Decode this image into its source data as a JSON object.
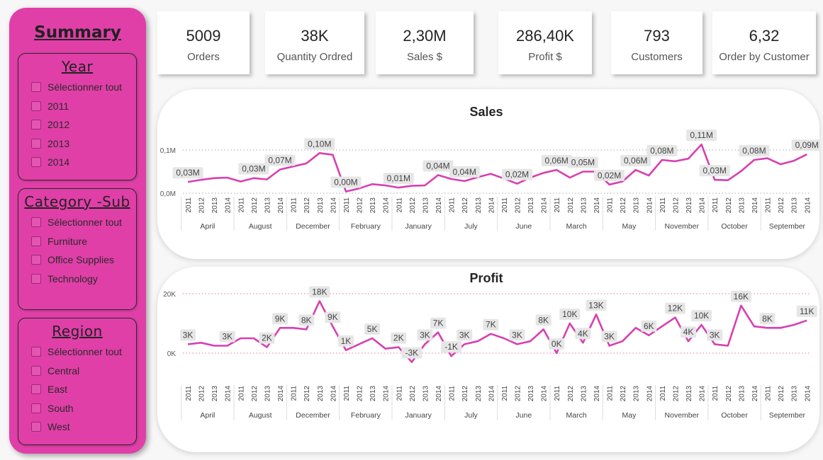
{
  "sidebar": {
    "title": "Summary",
    "year": {
      "title": "Year",
      "options": [
        "Sélectionner tout",
        "2011",
        "2012",
        "2013",
        "2014"
      ]
    },
    "category": {
      "title": "Category -Sub",
      "options": [
        "Sélectionner tout",
        "Furniture",
        "Office Supplies",
        "Technology"
      ]
    },
    "region": {
      "title": "Region",
      "options": [
        "Sélectionner tout",
        "Central",
        "East",
        "South",
        "West"
      ]
    }
  },
  "kpis": [
    {
      "value": "5009",
      "label": "Orders"
    },
    {
      "value": "38K",
      "label": "Quantity Ordred"
    },
    {
      "value": "2,30M",
      "label": "Sales $"
    },
    {
      "value": "286,40K",
      "label": "Profit $"
    },
    {
      "value": "793",
      "label": "Customers"
    },
    {
      "value": "6,32",
      "label": "Order by Customer"
    }
  ],
  "colors": {
    "accent": "#e03fa8",
    "line": "#d83fb1",
    "sidebar": "#e03fa8"
  },
  "chart_data": [
    {
      "type": "line",
      "title": "Sales",
      "x_years": [
        "2011",
        "2012",
        "2013",
        "2014"
      ],
      "x_months": [
        "April",
        "August",
        "December",
        "February",
        "January",
        "July",
        "June",
        "March",
        "May",
        "November",
        "October",
        "September"
      ],
      "y_ticks": [
        "0,0M",
        "0,1M"
      ],
      "ylim": [
        0,
        0.11
      ],
      "values": [
        0.026,
        0.031,
        0.035,
        0.036,
        0.027,
        0.035,
        0.032,
        0.055,
        0.062,
        0.069,
        0.093,
        0.089,
        0.004,
        0.011,
        0.021,
        0.018,
        0.013,
        0.017,
        0.018,
        0.042,
        0.033,
        0.028,
        0.037,
        0.045,
        0.034,
        0.022,
        0.036,
        0.047,
        0.054,
        0.036,
        0.05,
        0.05,
        0.02,
        0.027,
        0.054,
        0.041,
        0.077,
        0.074,
        0.08,
        0.113,
        0.031,
        0.03,
        0.051,
        0.077,
        0.081,
        0.067,
        0.075,
        0.09
      ],
      "data_labels": [
        "0,03M",
        "",
        "",
        "",
        "",
        "0,03M",
        "",
        "0,07M",
        "",
        "",
        "0,10M",
        "",
        "0,00M",
        "",
        "",
        "",
        "0,01M",
        "",
        "",
        "0,04M",
        "",
        "0,04M",
        "",
        "",
        "",
        "0,02M",
        "",
        "",
        "0,06M",
        "",
        "0,05M",
        "",
        "0,02M",
        "",
        "0,06M",
        "",
        "0,08M",
        "",
        "",
        "0,11M",
        "0,03M",
        "",
        "",
        "0,08M",
        "",
        "",
        "",
        "0,09M"
      ]
    },
    {
      "type": "line",
      "title": "Profit",
      "x_years": [
        "2011",
        "2012",
        "2013",
        "2014"
      ],
      "x_months": [
        "April",
        "August",
        "December",
        "February",
        "January",
        "July",
        "June",
        "March",
        "May",
        "November",
        "October",
        "September"
      ],
      "y_ticks": [
        "0K",
        "20K"
      ],
      "ylim": [
        -3,
        20
      ],
      "values": [
        3,
        3.5,
        2.5,
        2.5,
        5,
        5,
        2,
        8.5,
        8.5,
        8,
        17.5,
        9,
        1,
        3,
        5,
        1.5,
        2,
        -3,
        3,
        7,
        -1,
        3,
        4,
        6.5,
        5,
        3,
        4,
        8,
        0,
        10,
        3.5,
        13,
        2.5,
        4,
        8.5,
        6,
        9,
        12,
        4,
        9.5,
        3,
        2.5,
        16,
        9,
        8.5,
        8.5,
        9.5,
        11
      ],
      "data_labels": [
        "3K",
        "",
        "",
        "3K",
        "",
        "",
        "2K",
        "9K",
        "",
        "8K",
        "18K",
        "9K",
        "1K",
        "",
        "5K",
        "",
        "2K",
        "-3K",
        "3K",
        "7K",
        "-1K",
        "3K",
        "",
        "7K",
        "",
        "3K",
        "",
        "8K",
        "0K",
        "10K",
        "4K",
        "13K",
        "3K",
        "",
        "",
        "6K",
        "",
        "12K",
        "4K",
        "10K",
        "3K",
        "",
        "16K",
        "",
        "8K",
        "",
        "",
        "11K"
      ]
    }
  ]
}
